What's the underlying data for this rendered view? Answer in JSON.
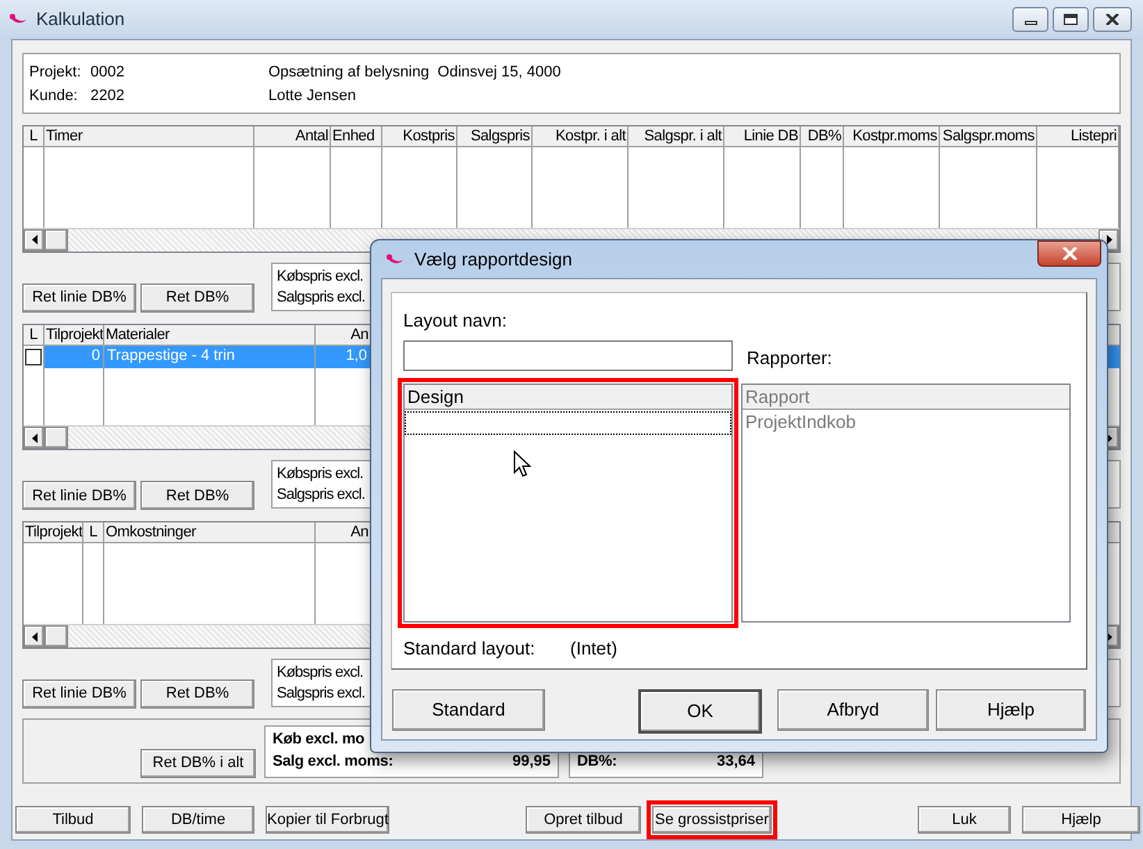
{
  "window": {
    "title": "Kalkulation"
  },
  "project": {
    "fields": [
      {
        "label": "Projekt:",
        "value": "0002"
      },
      {
        "label": "Kunde:",
        "value": "2202"
      }
    ],
    "description": [
      "Opsætning af belysning  Odinsvej 15, 4000",
      "Lotte Jensen"
    ]
  },
  "sections": [
    {
      "table": {
        "columns": [
          {
            "label": "L",
            "kind": "check"
          },
          {
            "label": "Timer",
            "kind": "text"
          },
          {
            "label": "Antal",
            "kind": "number"
          },
          {
            "label": "Enhed",
            "kind": "text"
          },
          {
            "label": "Kostpris",
            "kind": "number"
          },
          {
            "label": "Salgspris",
            "kind": "number"
          },
          {
            "label": "Kostpr. i alt",
            "kind": "number"
          },
          {
            "label": "Salgspr. i alt",
            "kind": "number"
          },
          {
            "label": "Linie DB",
            "kind": "number"
          },
          {
            "label": "DB%",
            "kind": "number"
          },
          {
            "label": "Kostpr.moms",
            "kind": "number"
          },
          {
            "label": "Salgspr.moms",
            "kind": "number"
          },
          {
            "label": "Listepri",
            "kind": "number"
          }
        ]
      },
      "buttons": [
        "Ret linie DB%",
        "Ret DB%"
      ],
      "info": [
        "Købspris excl.",
        "Salgspris excl."
      ]
    },
    {
      "table": {
        "columns": [
          {
            "label": "L",
            "kind": "check"
          },
          {
            "label": "Tilprojekt",
            "kind": "number"
          },
          {
            "label": "Materialer",
            "kind": "text"
          },
          {
            "label": "An",
            "kind": "number"
          }
        ],
        "rows": [
          {
            "selected": true,
            "checked": false,
            "cells": [
              "",
              "0",
              "Trappestige - 4 trin",
              "1,0"
            ]
          }
        ]
      },
      "buttons": [
        "Ret linie DB%",
        "Ret DB%"
      ],
      "info": [
        "Købspris excl.",
        "Salgspris excl."
      ]
    },
    {
      "table": {
        "columns": [
          {
            "label": "Tilprojekt",
            "kind": "number"
          },
          {
            "label": "L",
            "kind": "check"
          },
          {
            "label": "Omkostninger",
            "kind": "text"
          },
          {
            "label": "An",
            "kind": "number"
          }
        ]
      },
      "buttons": [
        "Ret linie DB%",
        "Ret DB%"
      ],
      "info": [
        "Købspris excl.",
        "Salgspris excl."
      ]
    }
  ],
  "totals": {
    "button": "Ret DB% i alt",
    "boxes": [
      {
        "lines": [
          {
            "label": "Køb excl. mo"
          },
          {
            "label": "Salg excl. moms:",
            "value": "99,95"
          }
        ]
      },
      {
        "lines": [
          {
            "label": "DB%:",
            "value": "33,64"
          }
        ]
      }
    ]
  },
  "footer_buttons": [
    {
      "label": "Tilbud",
      "highlighted": false
    },
    {
      "label": "DB/time",
      "highlighted": false
    },
    {
      "label": "Kopier til Forbrugt",
      "highlighted": false
    },
    {
      "label": "Opret tilbud",
      "highlighted": false
    },
    {
      "label": "Se grossistpriser",
      "highlighted": true
    },
    {
      "label": "Luk",
      "highlighted": false
    },
    {
      "label": "Hjælp",
      "highlighted": false
    }
  ],
  "dialog": {
    "title": "Vælg rapportdesign",
    "layout_name_label": "Layout navn:",
    "reports_label": "Rapporter:",
    "design_list": {
      "header": "Design",
      "highlighted": true,
      "focused_row": true
    },
    "report_list": {
      "header": "Rapport",
      "disabled": true,
      "items": [
        "ProjektIndkob"
      ]
    },
    "standard_layout": {
      "label": "Standard layout:",
      "value": "(Intet)"
    },
    "buttons": [
      {
        "label": "Standard",
        "default": false
      },
      {
        "label": "OK",
        "default": true
      },
      {
        "label": "Afbryd",
        "default": false
      },
      {
        "label": "Hjælp",
        "default": false
      }
    ]
  }
}
